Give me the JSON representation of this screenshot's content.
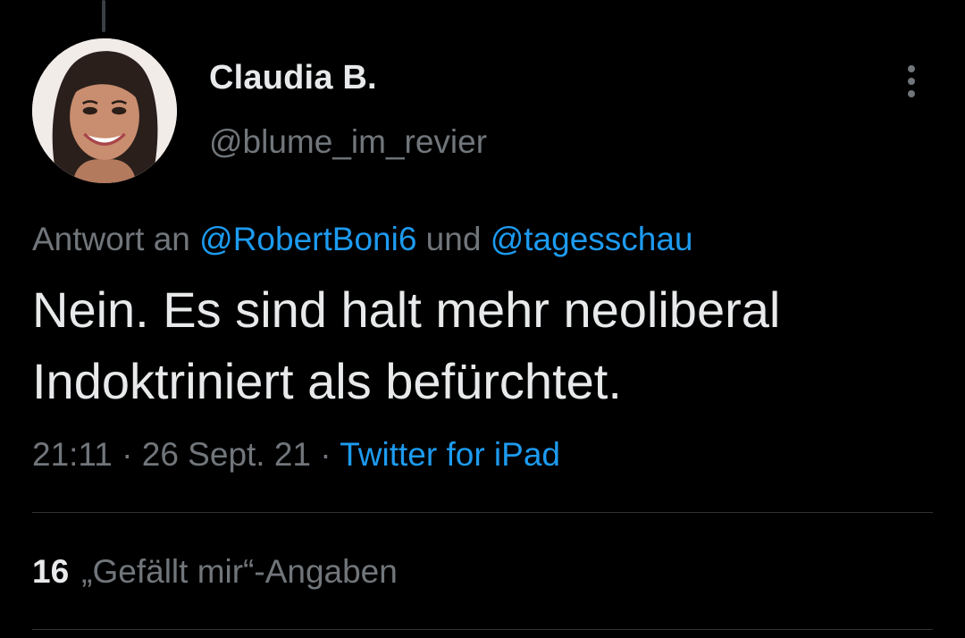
{
  "tweet": {
    "author": {
      "display_name": "Claudia B.",
      "handle": "@blume_im_revier",
      "avatar_icon": "profile-photo-avatar"
    },
    "more_icon": "more-options-icon",
    "reply_to": {
      "prefix": "Antwort an ",
      "mention_1": "@RobertBoni6",
      "joiner": " und ",
      "mention_2": "@tagesschau"
    },
    "text_lines": [
      "Nein. Es sind halt mehr neoliberal",
      "Indoktriniert als befürchtet."
    ],
    "time": "21:11",
    "separator_1": " · ",
    "date": "26 Sept. 21",
    "separator_2": " · ",
    "source": "Twitter for iPad",
    "likes": {
      "count": "16",
      "label": "„Gefällt mir“-Angaben"
    }
  },
  "colors": {
    "background": "#000000",
    "primary_text": "#e7e9ea",
    "secondary_text": "#71767b",
    "link": "#1d9bf0",
    "divider": "#2f3336"
  }
}
